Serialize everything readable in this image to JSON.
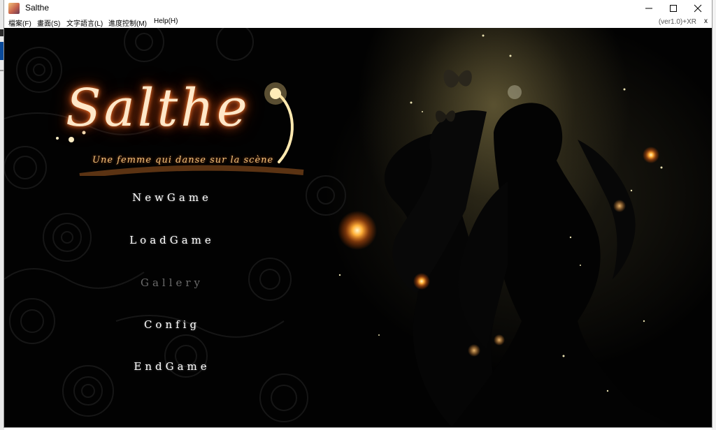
{
  "window": {
    "title": "Salthe",
    "controls": {
      "minimize": "minimize",
      "maximize": "maximize",
      "close": "close"
    }
  },
  "menubar": {
    "items": [
      "檔案(F)",
      "畫面(S)",
      "文字語言(L)",
      "進度控制(M)",
      "Help(H)"
    ],
    "version": "(ver1.0)+XR",
    "close": "x"
  },
  "game": {
    "logo": {
      "title": "Salthe",
      "subtitle": "Une femme qui danse sur la scène"
    },
    "menu": [
      {
        "label": "NewGame",
        "enabled": true
      },
      {
        "label": "LoadGame",
        "enabled": true
      },
      {
        "label": "Gallery",
        "enabled": false
      },
      {
        "label": "Config",
        "enabled": true
      },
      {
        "label": "EndGame",
        "enabled": true
      }
    ]
  },
  "colors": {
    "menu_text": "#ffffff",
    "menu_disabled": "#6b6b6b",
    "logo_glow": "#ff7a2a",
    "firefly": "#ff9a2a"
  },
  "icons": [
    "app-icon",
    "minimize-icon",
    "maximize-icon",
    "close-icon",
    "butterfly-icon"
  ]
}
